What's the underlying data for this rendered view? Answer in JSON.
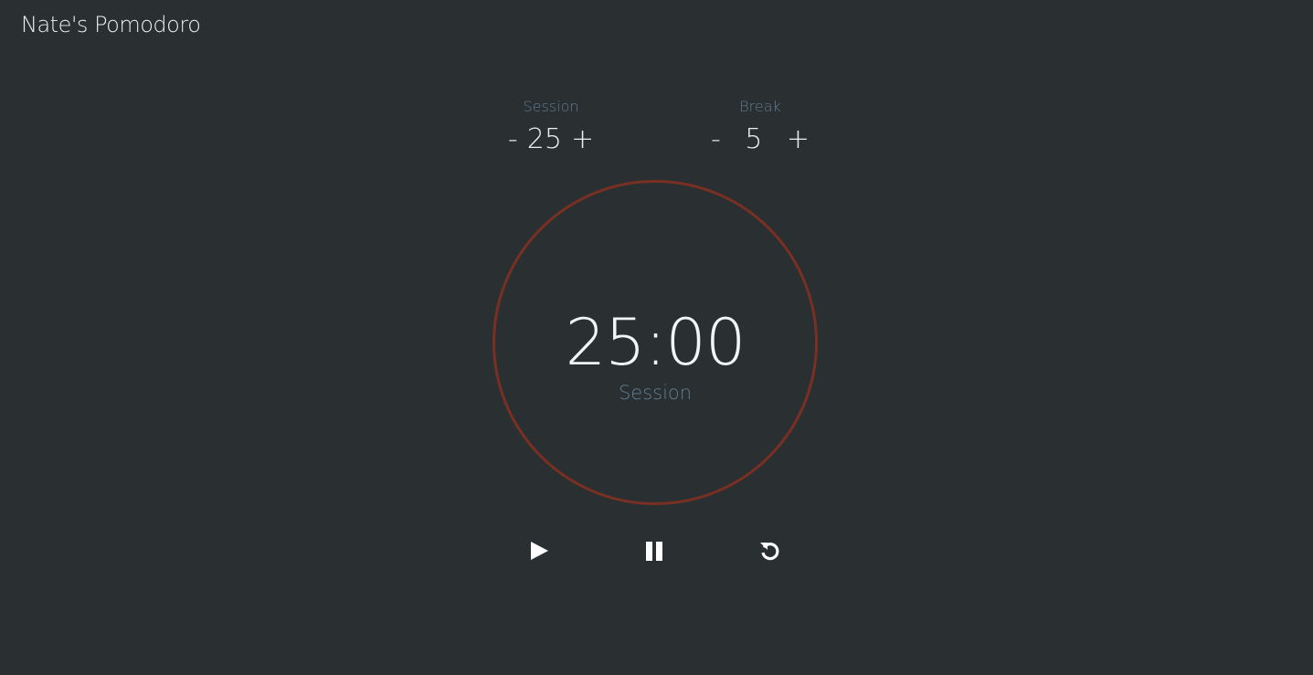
{
  "header": {
    "title": "Nate's Pomodoro"
  },
  "settings": {
    "session": {
      "label": "Session",
      "decrement": "-",
      "value": "25",
      "increment": "+"
    },
    "break": {
      "label": "Break",
      "decrement": "-",
      "value": "5",
      "increment": "+"
    }
  },
  "timer": {
    "time": "25:00",
    "mode": "Session"
  },
  "controls": {
    "play_icon": "play-icon",
    "pause_icon": "pause-icon",
    "reset_icon": "reset-icon"
  },
  "colors": {
    "background": "#2a3032",
    "ring": "#7a2f23",
    "label": "#5f7d93",
    "text": "#e9eef0"
  }
}
